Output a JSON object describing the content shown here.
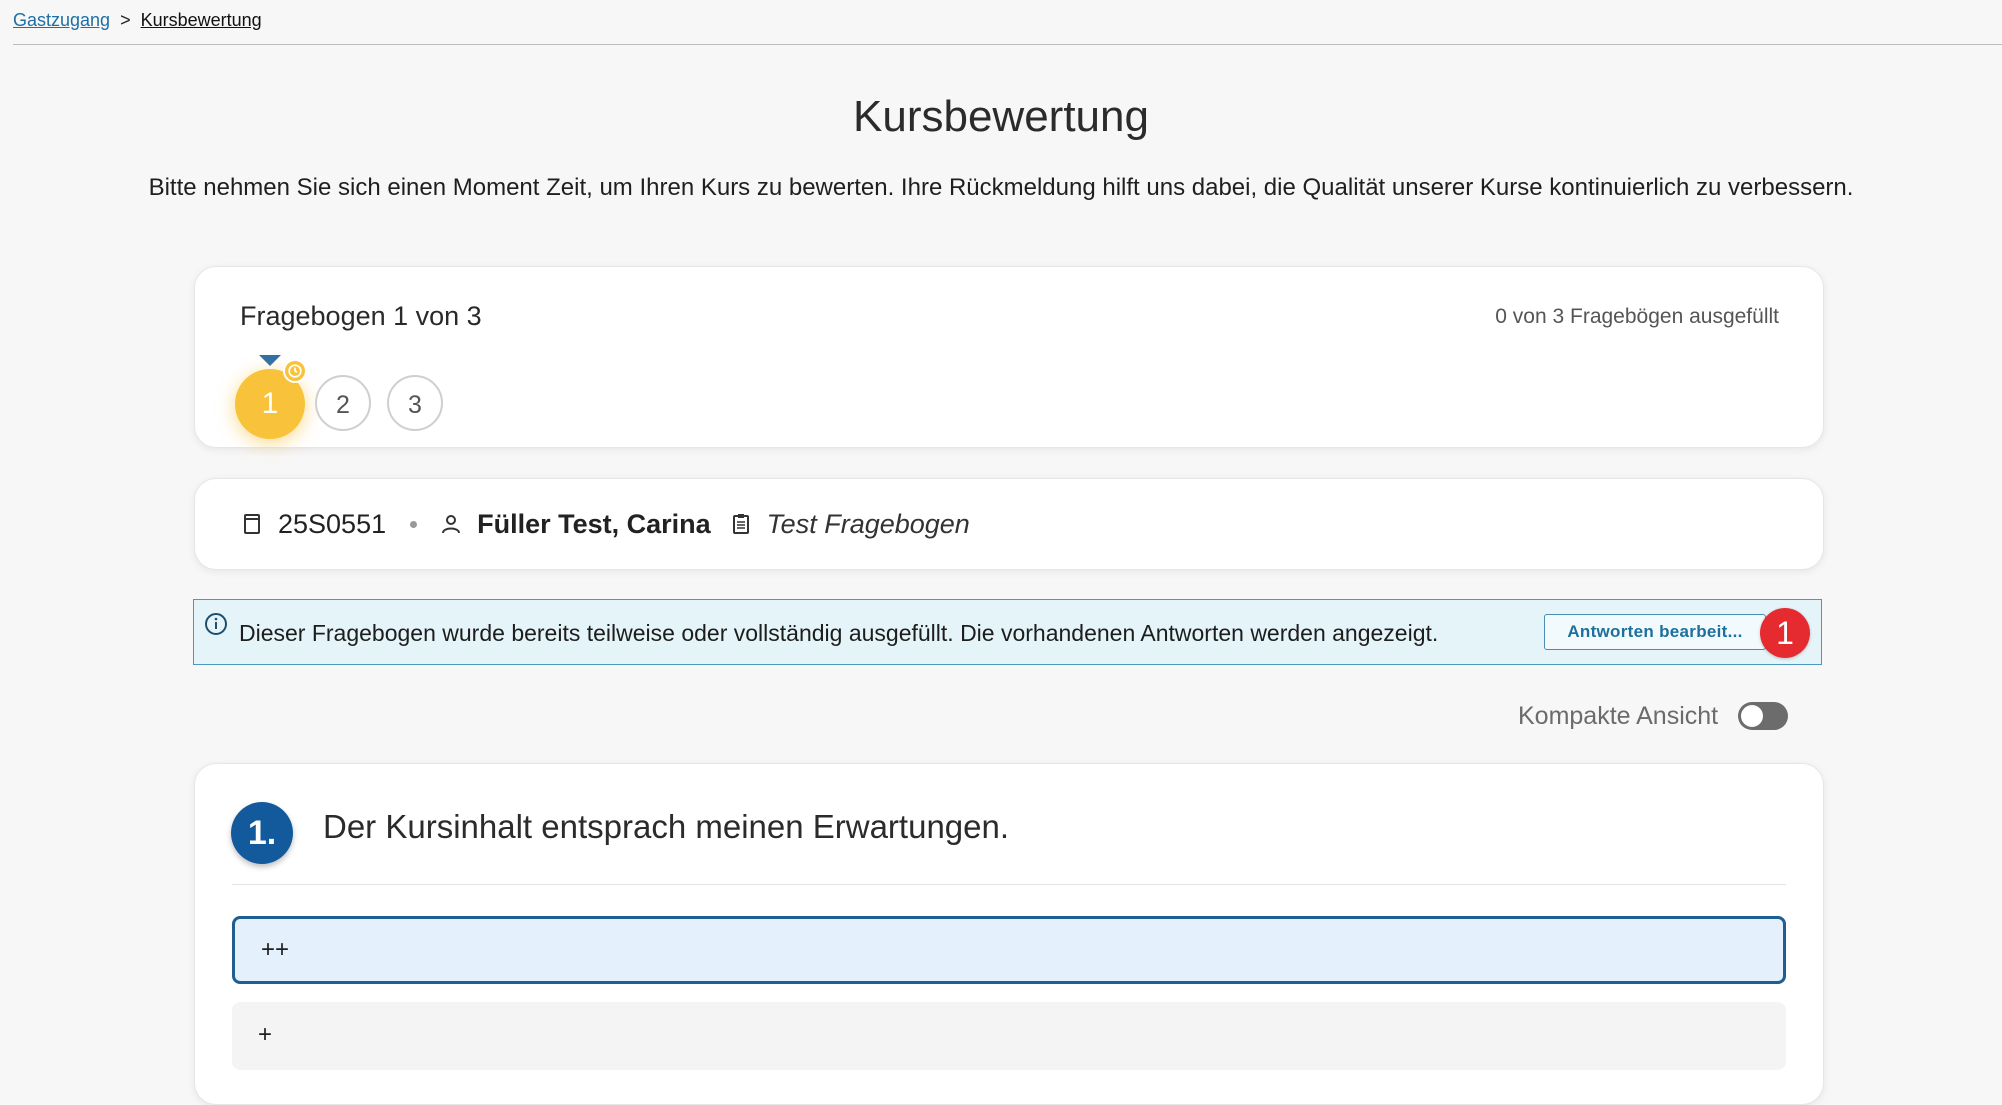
{
  "breadcrumb": {
    "home": "Gastzugang",
    "separator": ">",
    "current": "Kursbewertung"
  },
  "page": {
    "title": "Kursbewertung",
    "intro": "Bitte nehmen Sie sich einen Moment Zeit, um Ihren Kurs zu bewerten. Ihre Rückmeldung hilft uns dabei, die Qualität unserer Kurse kontinuierlich zu verbessern."
  },
  "progress": {
    "title": "Fragebogen 1 von 3",
    "count": "0 von 3 Fragebögen ausgefüllt",
    "steps": [
      "1",
      "2",
      "3"
    ],
    "active_step": 1
  },
  "meta": {
    "course_id": "25S0551",
    "person": "Füller Test, Carina",
    "questionnaire": "Test Fragebogen"
  },
  "info": {
    "text": "Dieser Fragebogen wurde bereits teilweise oder vollständig ausgefüllt. Die vorhandenen Antworten werden angezeigt.",
    "button": "Antworten bearbeit...",
    "badge": "1"
  },
  "compact_view": {
    "label": "Kompakte Ansicht",
    "enabled": false
  },
  "question": {
    "number": "1.",
    "text": "Der Kursinhalt entsprach meinen Erwartungen.",
    "options": [
      "++",
      "+"
    ],
    "selected": "++"
  },
  "colors": {
    "accent_blue": "#135a9c",
    "active_step": "#f8c33a",
    "badge_red": "#e52b30",
    "info_bg": "#e4f4f9"
  }
}
